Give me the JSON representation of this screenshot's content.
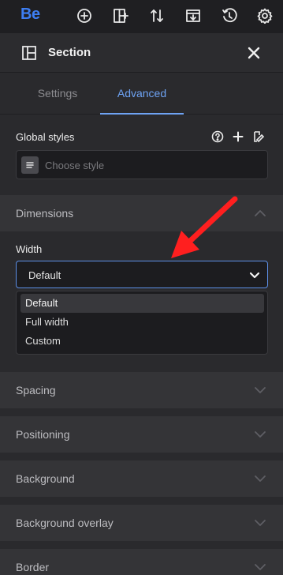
{
  "app": {
    "logo": "Be"
  },
  "toolbar": {
    "icons": [
      "plus-circle-icon",
      "add-section-icon",
      "sort-icon",
      "import-icon",
      "history-icon",
      "gear-icon"
    ]
  },
  "section": {
    "title": "Section",
    "close_icon": "close-icon"
  },
  "tabs": [
    {
      "label": "Settings",
      "active": false
    },
    {
      "label": "Advanced",
      "active": true
    }
  ],
  "global_styles": {
    "label": "Global styles",
    "placeholder": "Choose style",
    "icons": [
      "help-icon",
      "plus-icon",
      "edit-style-icon"
    ]
  },
  "dimensions": {
    "title": "Dimensions",
    "width_label": "Width",
    "width_value": "Default",
    "options": [
      "Default",
      "Full width",
      "Custom"
    ]
  },
  "accordions": [
    "Spacing",
    "Positioning",
    "Background",
    "Background overlay",
    "Border"
  ],
  "colors": {
    "accent": "#6ea3f4",
    "brand": "#3d7ef2",
    "annotation": "#ff1f1f"
  }
}
